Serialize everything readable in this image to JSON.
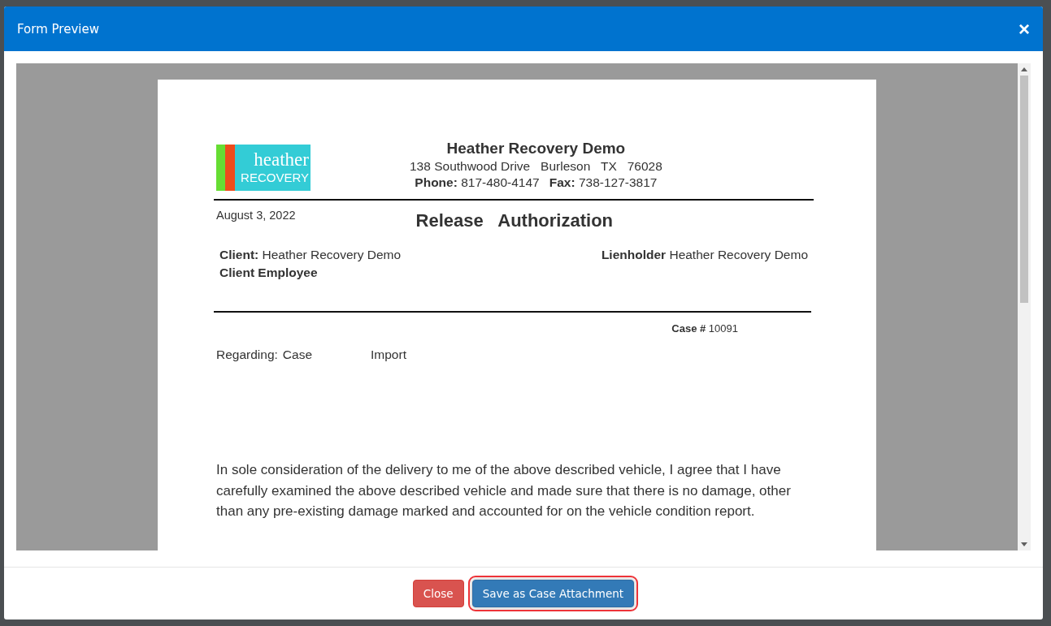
{
  "dialog": {
    "title": "Form Preview",
    "close_icon": "×"
  },
  "document": {
    "logo": {
      "line1": "heather",
      "line2": "RECOVERY"
    },
    "company": {
      "name": "Heather Recovery Demo",
      "address": "138 Southwood Drive   Burleson   TX   76028",
      "phone_label": "Phone:",
      "phone": "817-480-4147",
      "fax_label": "Fax:",
      "fax": "738-127-3817"
    },
    "date": "August 3, 2022",
    "title": "Release   Authorization",
    "client": {
      "label": "Client:",
      "value": "Heather Recovery Demo"
    },
    "client_employee": {
      "label": "Client Employee"
    },
    "lienholder": {
      "label": "Lienholder",
      "value": "Heather Recovery Demo"
    },
    "case": {
      "label": "Case #",
      "value": "10091"
    },
    "regarding": {
      "label": "Regarding:",
      "value_1": "Case",
      "value_2": "Import"
    },
    "paragraph": "In sole consideration of the delivery to me of the above described vehicle, I agree that I have carefully examined the above described vehicle  and made sure that there is no damage, other than any pre-existing damage marked and accounted for on the vehicle condition report."
  },
  "buttons": [
    {
      "label": "Close",
      "kind": "danger",
      "highlighted": false
    },
    {
      "label": "Save as Case Attachment",
      "kind": "primary",
      "highlighted": true
    }
  ]
}
